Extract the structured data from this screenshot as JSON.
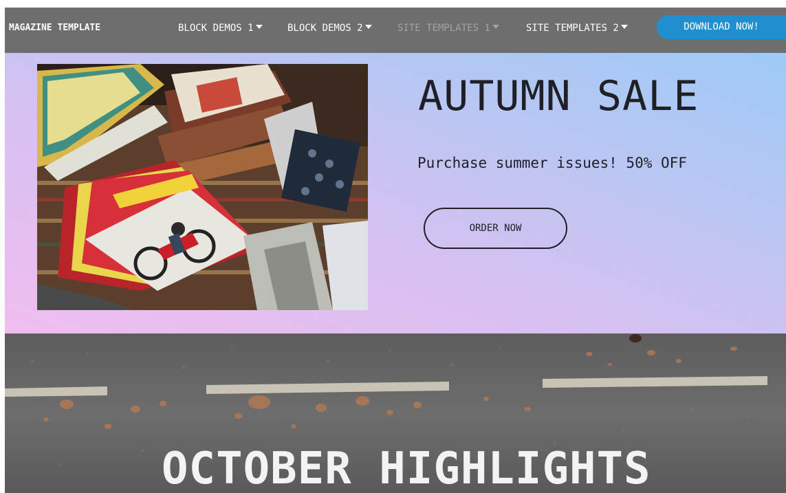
{
  "navbar": {
    "brand": "MAGAZINE TEMPLATE",
    "items": [
      {
        "label": "BLOCK DEMOS 1",
        "muted": false
      },
      {
        "label": "BLOCK DEMOS 2",
        "muted": false
      },
      {
        "label": "SITE TEMPLATES 1",
        "muted": true
      },
      {
        "label": "SITE TEMPLATES 2",
        "muted": false
      }
    ],
    "download_label": "DOWNLOAD NOW!",
    "bar_color": "#6e6e6e",
    "download_color": "#1f8fcf"
  },
  "hero": {
    "title": "AUTUMN SALE",
    "subtitle": "Purchase summer issues! 50% OFF",
    "order_label": "ORDER NOW",
    "image_icon": "magazines-photo",
    "gradient_colors": [
      "#f1bdf0",
      "#9ecbf4"
    ]
  },
  "highlights": {
    "title": "OCTOBER HIGHLIGHTS",
    "background_icon": "road-photo"
  }
}
